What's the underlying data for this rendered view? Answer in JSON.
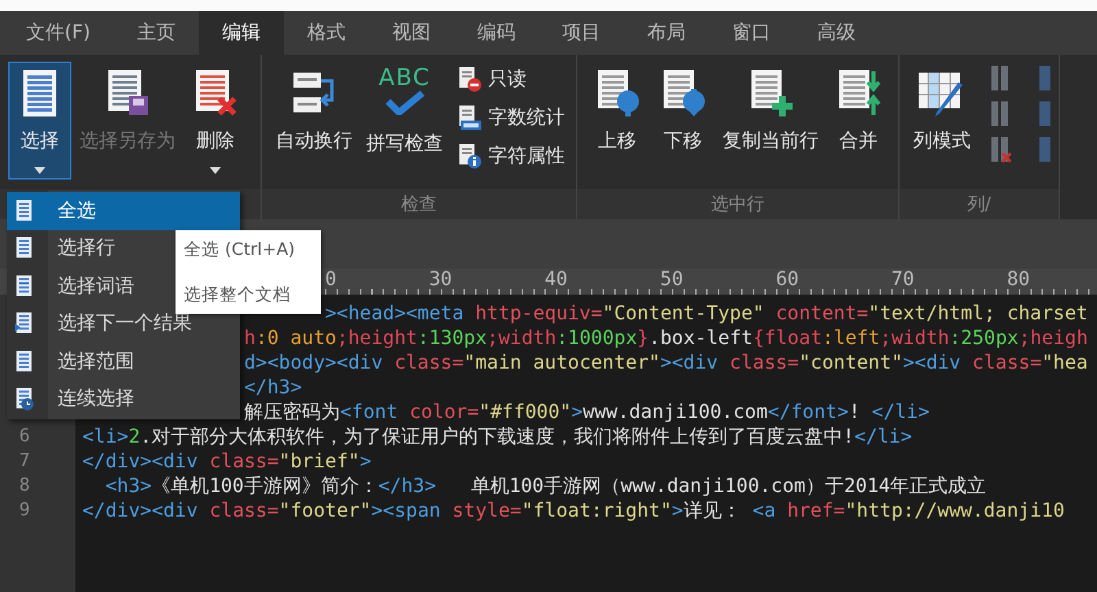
{
  "tabs": [
    {
      "label": "文件(F)",
      "selected": false
    },
    {
      "label": "主页",
      "selected": false
    },
    {
      "label": "编辑",
      "selected": true
    },
    {
      "label": "格式",
      "selected": false
    },
    {
      "label": "视图",
      "selected": false
    },
    {
      "label": "编码",
      "selected": false
    },
    {
      "label": "项目",
      "selected": false
    },
    {
      "label": "布局",
      "selected": false
    },
    {
      "label": "窗口",
      "selected": false
    },
    {
      "label": "高级",
      "selected": false
    }
  ],
  "ribbon": {
    "groups": [
      {
        "buttons": [
          {
            "kind": "large",
            "label": "选择",
            "selected": true,
            "disabled": false,
            "dropdown": true
          },
          {
            "kind": "large",
            "label": "选择另存为",
            "selected": false,
            "disabled": true,
            "dropdown": false
          },
          {
            "kind": "large",
            "label": "删除",
            "selected": false,
            "disabled": false,
            "dropdown": true
          }
        ]
      },
      {
        "label": "检查",
        "buttons": [
          {
            "kind": "large",
            "label": "自动换行",
            "selected": false,
            "disabled": false,
            "dropdown": false
          },
          {
            "kind": "large",
            "label": "拼写检查",
            "icon_text": "ABC",
            "selected": false,
            "disabled": false,
            "dropdown": false
          },
          {
            "kind": "small",
            "label": "只读"
          },
          {
            "kind": "small",
            "label": "字数统计"
          },
          {
            "kind": "small",
            "label": "字符属性"
          }
        ]
      },
      {
        "label": "选中行",
        "buttons": [
          {
            "kind": "large",
            "label": "上移",
            "selected": false,
            "disabled": false,
            "dropdown": false
          },
          {
            "kind": "large",
            "label": "下移",
            "selected": false,
            "disabled": false,
            "dropdown": false
          },
          {
            "kind": "large",
            "label": "复制当前行",
            "selected": false,
            "disabled": false,
            "dropdown": false
          },
          {
            "kind": "large",
            "label": "合并",
            "selected": false,
            "disabled": false,
            "dropdown": false
          }
        ]
      },
      {
        "label": "列/",
        "buttons": [
          {
            "kind": "large",
            "label": "列模式",
            "selected": false,
            "disabled": false,
            "dropdown": false
          },
          {
            "kind": "icons"
          }
        ]
      }
    ]
  },
  "ruler": {
    "labels": [
      {
        "text": "0",
        "partial": true
      },
      {
        "text": "30",
        "partial": false
      },
      {
        "text": "40",
        "partial": false
      },
      {
        "text": "50",
        "partial": false
      },
      {
        "text": "60",
        "partial": false
      },
      {
        "text": "70",
        "partial": false
      },
      {
        "text": "80",
        "partial": false
      }
    ]
  },
  "editor": {
    "lines": [
      {
        "covered": true,
        "segments": [
          {
            "kind": "tag",
            "text": "><head><meta "
          },
          {
            "kind": "attr",
            "text": "http-equiv="
          },
          {
            "kind": "str",
            "text": "\"Content-Type\" "
          },
          {
            "kind": "attr",
            "text": "content="
          },
          {
            "kind": "str",
            "text": "\"text/html; charset"
          }
        ]
      },
      {
        "covered": true,
        "segments": [
          {
            "kind": "prop",
            "text": "h"
          },
          {
            "kind": "val",
            "text": ":0 auto"
          },
          {
            "kind": "prop",
            "text": ";height"
          },
          {
            "kind": "num",
            "text": ":130px"
          },
          {
            "kind": "prop",
            "text": ";width"
          },
          {
            "kind": "num",
            "text": ":1000px"
          },
          {
            "kind": "prop",
            "text": "}"
          },
          {
            "kind": "text",
            "text": ".box-left"
          },
          {
            "kind": "prop",
            "text": "{float"
          },
          {
            "kind": "val",
            "text": ":left"
          },
          {
            "kind": "prop",
            "text": ";width"
          },
          {
            "kind": "num",
            "text": ":250px"
          },
          {
            "kind": "prop",
            "text": ";heigh"
          }
        ]
      },
      {
        "covered": true,
        "segments": [
          {
            "kind": "tag",
            "text": "d><body><div "
          },
          {
            "kind": "attr",
            "text": "class="
          },
          {
            "kind": "str",
            "text": "\"main autocenter\""
          },
          {
            "kind": "tag",
            "text": "><div "
          },
          {
            "kind": "attr",
            "text": "class="
          },
          {
            "kind": "str",
            "text": "\"content\""
          },
          {
            "kind": "tag",
            "text": "><div "
          },
          {
            "kind": "attr",
            "text": "class="
          },
          {
            "kind": "str",
            "text": "\"hea"
          }
        ]
      },
      {
        "covered": true,
        "segments": [
          {
            "kind": "tag",
            "text": "</h3>"
          }
        ]
      },
      {
        "covered": true,
        "segments": [
          {
            "kind": "text",
            "text": "解压密码为"
          },
          {
            "kind": "tag",
            "text": "<font "
          },
          {
            "kind": "attr",
            "text": "color="
          },
          {
            "kind": "str",
            "text": "\"#ff000\""
          },
          {
            "kind": "tag",
            "text": ">"
          },
          {
            "kind": "text",
            "text": "www.danji100.com"
          },
          {
            "kind": "tag",
            "text": "</font>"
          },
          {
            "kind": "text",
            "text": "! "
          },
          {
            "kind": "tag",
            "text": "</li>"
          }
        ]
      },
      {
        "number": "6",
        "segments": [
          {
            "kind": "tag",
            "text": "<li>"
          },
          {
            "kind": "num",
            "text": "2"
          },
          {
            "kind": "text",
            "text": ".对于部分大体积软件，为了保证用户的下载速度，我们将附件上传到了百度云盘中!"
          },
          {
            "kind": "tag",
            "text": "</li>"
          }
        ]
      },
      {
        "number": "7",
        "segments": [
          {
            "kind": "tag",
            "text": "</div><div "
          },
          {
            "kind": "attr",
            "text": "class="
          },
          {
            "kind": "str",
            "text": "\"brief\""
          },
          {
            "kind": "tag",
            "text": ">"
          }
        ]
      },
      {
        "number": "8",
        "segments": [
          {
            "kind": "tag",
            "text": "  <h3>"
          },
          {
            "kind": "text",
            "text": "《单机100手游网》简介："
          },
          {
            "kind": "tag",
            "text": "</h3>"
          },
          {
            "kind": "text",
            "text": "   单机100手游网（www.danji100.com）于2014年正式成立"
          }
        ]
      },
      {
        "number": "9",
        "segments": [
          {
            "kind": "tag",
            "text": "</div><div "
          },
          {
            "kind": "attr",
            "text": "class="
          },
          {
            "kind": "str",
            "text": "\"footer\""
          },
          {
            "kind": "tag",
            "text": "><span "
          },
          {
            "kind": "attr",
            "text": "style="
          },
          {
            "kind": "str",
            "text": "\"float:right\""
          },
          {
            "kind": "tag",
            "text": ">"
          },
          {
            "kind": "text",
            "text": "详见： "
          },
          {
            "kind": "tag",
            "text": "<a "
          },
          {
            "kind": "attr",
            "text": "href="
          },
          {
            "kind": "str",
            "text": "\"http://www.danji10"
          }
        ]
      }
    ]
  },
  "menu": {
    "items": [
      {
        "label": "全选",
        "selected": true
      },
      {
        "label": "选择行",
        "selected": false
      },
      {
        "label": "选择词语",
        "selected": false
      },
      {
        "label": "选择下一个结果",
        "selected": false
      },
      {
        "label": "选择范围",
        "selected": false
      },
      {
        "label": "连续选择",
        "selected": false
      }
    ]
  },
  "tooltip": {
    "title": "全选 (Ctrl+A)",
    "description": "选择整个文档"
  }
}
